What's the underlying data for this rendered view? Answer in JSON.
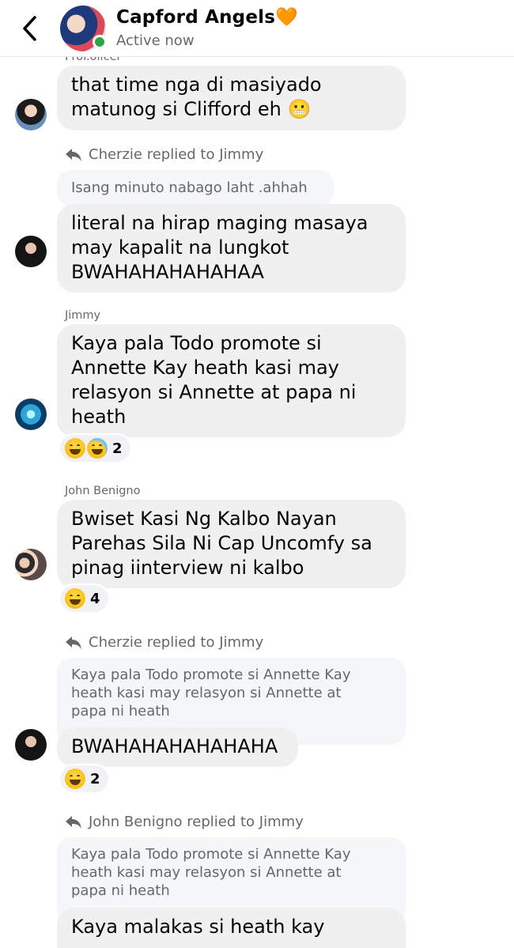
{
  "header": {
    "title": "Capford Angels🧡",
    "status": "Active now"
  },
  "messages": [
    {
      "sender": "Prof.olicer",
      "text_lines": [
        "that time nga di masiyado",
        "matunog si Clifford eh 😬"
      ]
    },
    {
      "reply_label": "Cherzie replied to Jimmy",
      "quote": "Isang minuto nabago laht .ahhah",
      "text_lines": [
        "literal na hirap maging masaya",
        "may kapalit na lungkot",
        "BWAHAHAHAHAHAA"
      ]
    },
    {
      "sender": "Jimmy",
      "text_lines": [
        "Kaya pala Todo promote si",
        "Annette Kay heath kasi may",
        "relasyon si Annette at papa ni",
        "heath"
      ],
      "reaction_count": "2"
    },
    {
      "sender": "John Benigno",
      "text_lines": [
        "Bwiset Kasi Ng Kalbo Nayan",
        "Parehas Sila Ni Cap Uncomfy sa",
        "pinag iinterview ni kalbo"
      ],
      "reaction_count": "4"
    },
    {
      "reply_label": "Cherzie replied to Jimmy",
      "quote_lines": [
        "Kaya pala Todo promote si Annette Kay",
        "heath kasi may relasyon si Annette at",
        "papa ni heath"
      ],
      "text_lines": [
        "BWAHAHAHAHAHAHA"
      ],
      "reaction_count": "2"
    },
    {
      "reply_label": "John Benigno replied to Jimmy",
      "quote_lines": [
        "Kaya pala Todo promote si Annette Kay",
        "heath kasi may relasyon si Annette at",
        "papa ni heath"
      ],
      "text_lines": [
        "Kaya malakas si heath kay"
      ]
    }
  ],
  "colors": {
    "bubble": "#f0f0f0",
    "online": "#31a24c",
    "muted": "#65676b"
  }
}
